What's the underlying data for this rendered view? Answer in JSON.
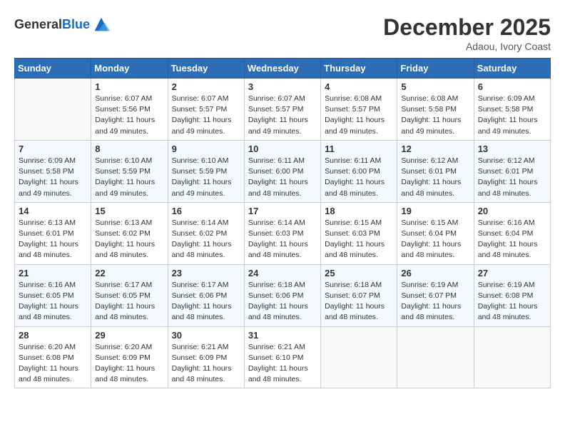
{
  "header": {
    "logo_general": "General",
    "logo_blue": "Blue",
    "month_year": "December 2025",
    "location": "Adaou, Ivory Coast"
  },
  "weekdays": [
    "Sunday",
    "Monday",
    "Tuesday",
    "Wednesday",
    "Thursday",
    "Friday",
    "Saturday"
  ],
  "weeks": [
    [
      {
        "day": "",
        "sunrise": "",
        "sunset": "",
        "daylight": ""
      },
      {
        "day": "1",
        "sunrise": "Sunrise: 6:07 AM",
        "sunset": "Sunset: 5:56 PM",
        "daylight": "Daylight: 11 hours and 49 minutes."
      },
      {
        "day": "2",
        "sunrise": "Sunrise: 6:07 AM",
        "sunset": "Sunset: 5:57 PM",
        "daylight": "Daylight: 11 hours and 49 minutes."
      },
      {
        "day": "3",
        "sunrise": "Sunrise: 6:07 AM",
        "sunset": "Sunset: 5:57 PM",
        "daylight": "Daylight: 11 hours and 49 minutes."
      },
      {
        "day": "4",
        "sunrise": "Sunrise: 6:08 AM",
        "sunset": "Sunset: 5:57 PM",
        "daylight": "Daylight: 11 hours and 49 minutes."
      },
      {
        "day": "5",
        "sunrise": "Sunrise: 6:08 AM",
        "sunset": "Sunset: 5:58 PM",
        "daylight": "Daylight: 11 hours and 49 minutes."
      },
      {
        "day": "6",
        "sunrise": "Sunrise: 6:09 AM",
        "sunset": "Sunset: 5:58 PM",
        "daylight": "Daylight: 11 hours and 49 minutes."
      }
    ],
    [
      {
        "day": "7",
        "sunrise": "Sunrise: 6:09 AM",
        "sunset": "Sunset: 5:58 PM",
        "daylight": "Daylight: 11 hours and 49 minutes."
      },
      {
        "day": "8",
        "sunrise": "Sunrise: 6:10 AM",
        "sunset": "Sunset: 5:59 PM",
        "daylight": "Daylight: 11 hours and 49 minutes."
      },
      {
        "day": "9",
        "sunrise": "Sunrise: 6:10 AM",
        "sunset": "Sunset: 5:59 PM",
        "daylight": "Daylight: 11 hours and 49 minutes."
      },
      {
        "day": "10",
        "sunrise": "Sunrise: 6:11 AM",
        "sunset": "Sunset: 6:00 PM",
        "daylight": "Daylight: 11 hours and 48 minutes."
      },
      {
        "day": "11",
        "sunrise": "Sunrise: 6:11 AM",
        "sunset": "Sunset: 6:00 PM",
        "daylight": "Daylight: 11 hours and 48 minutes."
      },
      {
        "day": "12",
        "sunrise": "Sunrise: 6:12 AM",
        "sunset": "Sunset: 6:01 PM",
        "daylight": "Daylight: 11 hours and 48 minutes."
      },
      {
        "day": "13",
        "sunrise": "Sunrise: 6:12 AM",
        "sunset": "Sunset: 6:01 PM",
        "daylight": "Daylight: 11 hours and 48 minutes."
      }
    ],
    [
      {
        "day": "14",
        "sunrise": "Sunrise: 6:13 AM",
        "sunset": "Sunset: 6:01 PM",
        "daylight": "Daylight: 11 hours and 48 minutes."
      },
      {
        "day": "15",
        "sunrise": "Sunrise: 6:13 AM",
        "sunset": "Sunset: 6:02 PM",
        "daylight": "Daylight: 11 hours and 48 minutes."
      },
      {
        "day": "16",
        "sunrise": "Sunrise: 6:14 AM",
        "sunset": "Sunset: 6:02 PM",
        "daylight": "Daylight: 11 hours and 48 minutes."
      },
      {
        "day": "17",
        "sunrise": "Sunrise: 6:14 AM",
        "sunset": "Sunset: 6:03 PM",
        "daylight": "Daylight: 11 hours and 48 minutes."
      },
      {
        "day": "18",
        "sunrise": "Sunrise: 6:15 AM",
        "sunset": "Sunset: 6:03 PM",
        "daylight": "Daylight: 11 hours and 48 minutes."
      },
      {
        "day": "19",
        "sunrise": "Sunrise: 6:15 AM",
        "sunset": "Sunset: 6:04 PM",
        "daylight": "Daylight: 11 hours and 48 minutes."
      },
      {
        "day": "20",
        "sunrise": "Sunrise: 6:16 AM",
        "sunset": "Sunset: 6:04 PM",
        "daylight": "Daylight: 11 hours and 48 minutes."
      }
    ],
    [
      {
        "day": "21",
        "sunrise": "Sunrise: 6:16 AM",
        "sunset": "Sunset: 6:05 PM",
        "daylight": "Daylight: 11 hours and 48 minutes."
      },
      {
        "day": "22",
        "sunrise": "Sunrise: 6:17 AM",
        "sunset": "Sunset: 6:05 PM",
        "daylight": "Daylight: 11 hours and 48 minutes."
      },
      {
        "day": "23",
        "sunrise": "Sunrise: 6:17 AM",
        "sunset": "Sunset: 6:06 PM",
        "daylight": "Daylight: 11 hours and 48 minutes."
      },
      {
        "day": "24",
        "sunrise": "Sunrise: 6:18 AM",
        "sunset": "Sunset: 6:06 PM",
        "daylight": "Daylight: 11 hours and 48 minutes."
      },
      {
        "day": "25",
        "sunrise": "Sunrise: 6:18 AM",
        "sunset": "Sunset: 6:07 PM",
        "daylight": "Daylight: 11 hours and 48 minutes."
      },
      {
        "day": "26",
        "sunrise": "Sunrise: 6:19 AM",
        "sunset": "Sunset: 6:07 PM",
        "daylight": "Daylight: 11 hours and 48 minutes."
      },
      {
        "day": "27",
        "sunrise": "Sunrise: 6:19 AM",
        "sunset": "Sunset: 6:08 PM",
        "daylight": "Daylight: 11 hours and 48 minutes."
      }
    ],
    [
      {
        "day": "28",
        "sunrise": "Sunrise: 6:20 AM",
        "sunset": "Sunset: 6:08 PM",
        "daylight": "Daylight: 11 hours and 48 minutes."
      },
      {
        "day": "29",
        "sunrise": "Sunrise: 6:20 AM",
        "sunset": "Sunset: 6:09 PM",
        "daylight": "Daylight: 11 hours and 48 minutes."
      },
      {
        "day": "30",
        "sunrise": "Sunrise: 6:21 AM",
        "sunset": "Sunset: 6:09 PM",
        "daylight": "Daylight: 11 hours and 48 minutes."
      },
      {
        "day": "31",
        "sunrise": "Sunrise: 6:21 AM",
        "sunset": "Sunset: 6:10 PM",
        "daylight": "Daylight: 11 hours and 48 minutes."
      },
      {
        "day": "",
        "sunrise": "",
        "sunset": "",
        "daylight": ""
      },
      {
        "day": "",
        "sunrise": "",
        "sunset": "",
        "daylight": ""
      },
      {
        "day": "",
        "sunrise": "",
        "sunset": "",
        "daylight": ""
      }
    ]
  ]
}
